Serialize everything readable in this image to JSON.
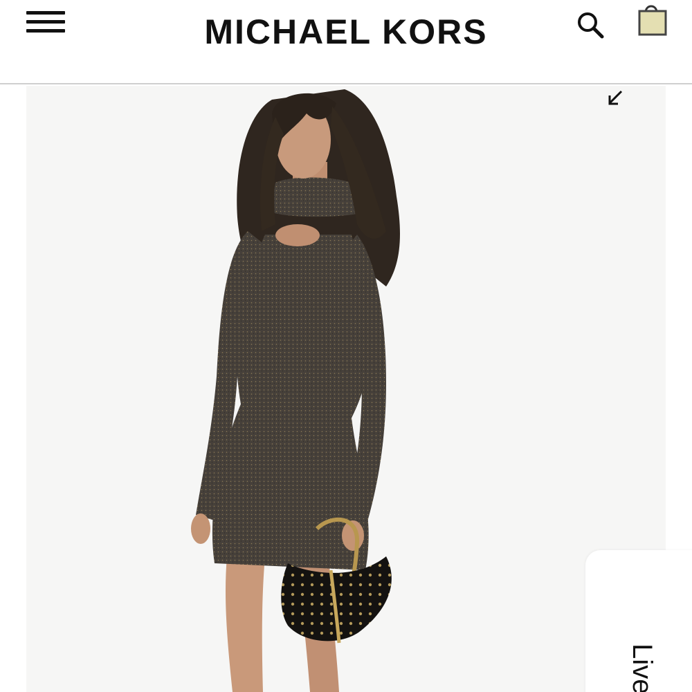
{
  "header": {
    "brand": "MICHAEL KORS",
    "menu_icon": "hamburger-menu-icon",
    "search_icon": "search-icon",
    "bag_icon": "shopping-bag-icon"
  },
  "product": {
    "image_description_icon": "product-photo",
    "zoom_icon": "collapse-arrow-icon"
  },
  "live_chat": {
    "label": "Live"
  },
  "colors": {
    "text": "#111111",
    "header_border": "#cfcfcf",
    "image_bg": "#f6f6f5",
    "dress": "#4a443e",
    "bag_fill": "#e4dfb2"
  }
}
